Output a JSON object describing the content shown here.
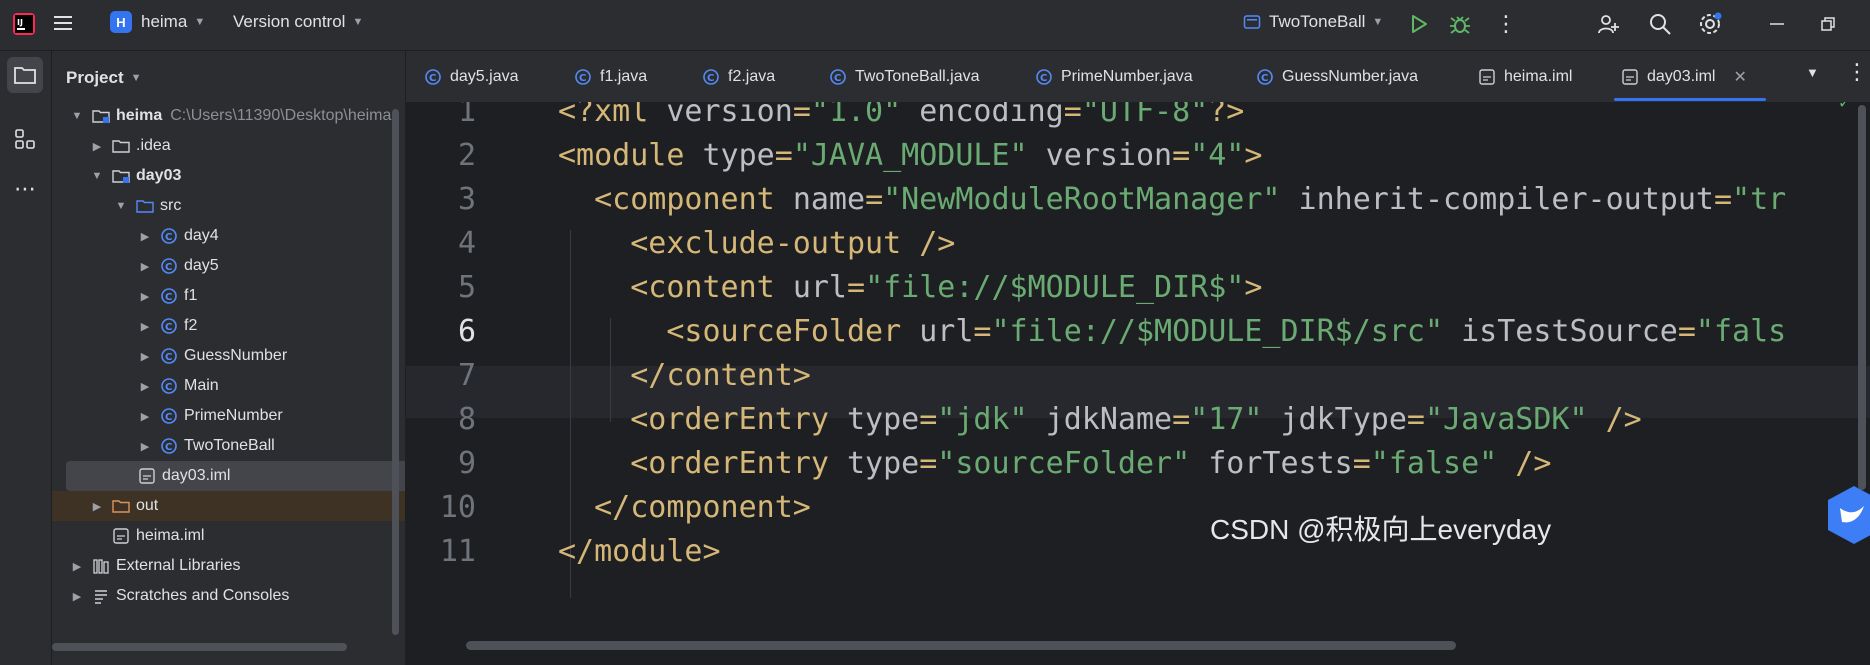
{
  "titlebar": {
    "project_badge": "H",
    "project_name": "heima",
    "vcs_label": "Version control",
    "run_config": "TwoToneBall"
  },
  "project_panel": {
    "title": "Project",
    "tree": [
      {
        "label": "heima",
        "path": "C:\\Users\\11390\\Desktop\\heima",
        "bold": true
      },
      {
        "label": ".idea"
      },
      {
        "label": "day03",
        "bold": true
      },
      {
        "label": "src"
      },
      {
        "label": "day4"
      },
      {
        "label": "day5"
      },
      {
        "label": "f1"
      },
      {
        "label": "f2"
      },
      {
        "label": "GuessNumber"
      },
      {
        "label": "Main"
      },
      {
        "label": "PrimeNumber"
      },
      {
        "label": "TwoToneBall"
      },
      {
        "label": "day03.iml"
      },
      {
        "label": "out"
      },
      {
        "label": "heima.iml"
      },
      {
        "label": "External Libraries"
      },
      {
        "label": "Scratches and Consoles"
      }
    ]
  },
  "tabs": [
    {
      "label": "day5.java"
    },
    {
      "label": "f1.java"
    },
    {
      "label": "f2.java"
    },
    {
      "label": "TwoToneBall.java"
    },
    {
      "label": "PrimeNumber.java"
    },
    {
      "label": "GuessNumber.java"
    },
    {
      "label": "heima.iml"
    },
    {
      "label": "day03.iml",
      "active": true
    }
  ],
  "editor": {
    "line_numbers": [
      "1",
      "2",
      "3",
      "4",
      "5",
      "6",
      "7",
      "8",
      "9",
      "10",
      "11"
    ],
    "current_line": "6",
    "lines": [
      [
        [
          "tag",
          "<?xml "
        ],
        [
          "attr",
          "version"
        ],
        [
          "tag",
          "="
        ],
        [
          "str",
          "\"1.0\""
        ],
        [
          "attr",
          " encoding"
        ],
        [
          "tag",
          "="
        ],
        [
          "str",
          "\"UTF-8\""
        ],
        [
          "tag",
          "?>"
        ]
      ],
      [
        [
          "tag",
          "<module "
        ],
        [
          "attr",
          "type"
        ],
        [
          "tag",
          "="
        ],
        [
          "str",
          "\"JAVA_MODULE\""
        ],
        [
          "attr",
          " version"
        ],
        [
          "tag",
          "="
        ],
        [
          "str",
          "\"4\""
        ],
        [
          "tag",
          ">"
        ]
      ],
      [
        [
          "tag",
          "  <component "
        ],
        [
          "attr",
          "name"
        ],
        [
          "tag",
          "="
        ],
        [
          "str",
          "\"NewModuleRootManager\""
        ],
        [
          "attr",
          " inherit-compiler-output"
        ],
        [
          "tag",
          "="
        ],
        [
          "str",
          "\"tr"
        ]
      ],
      [
        [
          "tag",
          "    <exclude-output />"
        ]
      ],
      [
        [
          "tag",
          "    <content "
        ],
        [
          "attr",
          "url"
        ],
        [
          "tag",
          "="
        ],
        [
          "str",
          "\"file://$MODULE_DIR$\""
        ],
        [
          "tag",
          ">"
        ]
      ],
      [
        [
          "tag",
          "      <sourceFolder "
        ],
        [
          "attr",
          "url"
        ],
        [
          "tag",
          "="
        ],
        [
          "str",
          "\"file://$MODULE_DIR$/src\""
        ],
        [
          "attr",
          " isTestSource"
        ],
        [
          "tag",
          "="
        ],
        [
          "str",
          "\"fals"
        ]
      ],
      [
        [
          "tag",
          "    </content>"
        ]
      ],
      [
        [
          "tag",
          "    <orderEntry "
        ],
        [
          "attr",
          "type"
        ],
        [
          "tag",
          "="
        ],
        [
          "str",
          "\"jdk\""
        ],
        [
          "attr",
          " jdkName"
        ],
        [
          "tag",
          "="
        ],
        [
          "str",
          "\"17\""
        ],
        [
          "attr",
          " jdkType"
        ],
        [
          "tag",
          "="
        ],
        [
          "str",
          "\"JavaSDK\""
        ],
        [
          "tag",
          " />"
        ]
      ],
      [
        [
          "tag",
          "    <orderEntry "
        ],
        [
          "attr",
          "type"
        ],
        [
          "tag",
          "="
        ],
        [
          "str",
          "\"sourceFolder\""
        ],
        [
          "attr",
          " forTests"
        ],
        [
          "tag",
          "="
        ],
        [
          "str",
          "\"false\""
        ],
        [
          "tag",
          " />"
        ]
      ],
      [
        [
          "tag",
          "  </component>"
        ]
      ],
      [
        [
          "tag",
          "</module>"
        ]
      ]
    ]
  },
  "watermark": "CSDN @积极向上everyday",
  "colors": {
    "tag": "#d5b778",
    "attr": "#bcbec4",
    "string": "#6aab73",
    "accent": "#3574f0"
  }
}
